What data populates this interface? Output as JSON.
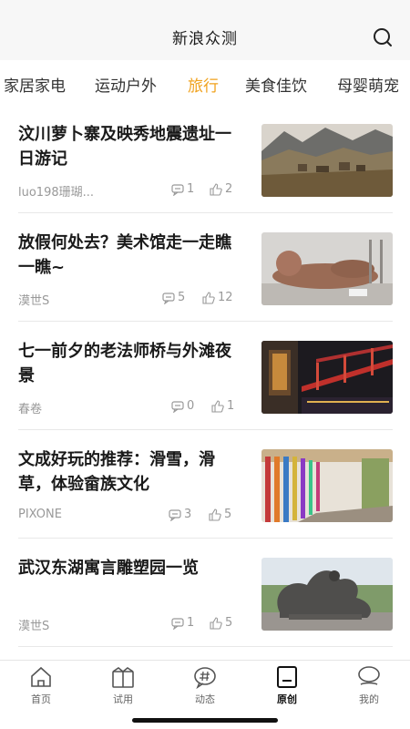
{
  "header": {
    "title": "新浪众测"
  },
  "categories": [
    {
      "label": "家居家电",
      "active": false
    },
    {
      "label": "运动户外",
      "active": false
    },
    {
      "label": "旅行",
      "active": true
    },
    {
      "label": "美食佳饮",
      "active": false
    },
    {
      "label": "母婴萌宠",
      "active": false
    }
  ],
  "articles": [
    {
      "title": "汶川萝卜寨及映秀地震遗址一日游记",
      "author": "luo198珊瑚...",
      "comments": "1",
      "likes": "2"
    },
    {
      "title": "放假何处去？美术馆走一走瞧一瞧~",
      "author": "漠世S",
      "comments": "5",
      "likes": "12"
    },
    {
      "title": "七一前夕的老法师桥与外滩夜景",
      "author": "春卷",
      "comments": "0",
      "likes": "1"
    },
    {
      "title": "文成好玩的推荐：滑雪，滑草，体验畲族文化",
      "author": "PIXONE",
      "comments": "3",
      "likes": "5"
    },
    {
      "title": "武汉东湖寓言雕塑园一览",
      "author": "漠世S",
      "comments": "1",
      "likes": "5"
    }
  ],
  "tabs": [
    {
      "label": "首页",
      "icon": "home-icon"
    },
    {
      "label": "试用",
      "icon": "gift-icon"
    },
    {
      "label": "动态",
      "icon": "chat-hash-icon"
    },
    {
      "label": "原创",
      "icon": "document-icon",
      "active": true
    },
    {
      "label": "我的",
      "icon": "profile-icon"
    }
  ],
  "colors": {
    "accent": "#f0a21e",
    "text": "#1a1a1a",
    "muted": "#999999"
  }
}
